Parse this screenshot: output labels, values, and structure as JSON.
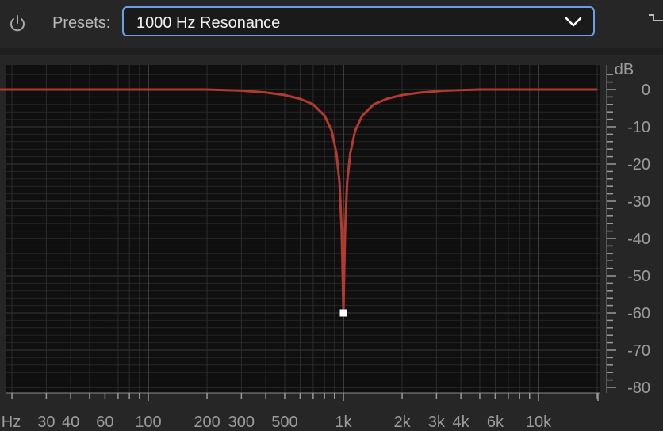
{
  "toolbar": {
    "power_icon": "power-icon",
    "presets_label": "Presets:",
    "preset_value": "1000 Hz Resonance",
    "chevron_icon": "chevron-down-icon",
    "corner_icon": "collapse-icon"
  },
  "colors": {
    "background": "#262626",
    "graph_bg": "#0f0f0f",
    "curve": "#b43a30",
    "select_border": "#6a9ee8",
    "handle": "#ffffff"
  },
  "chart_data": {
    "type": "line",
    "x_scale": "log",
    "xlim": [
      10,
      22000
    ],
    "ylim": [
      -82,
      5
    ],
    "x_unit": "Hz",
    "y_unit": "dB",
    "x_ticks": [
      {
        "label": "Hz",
        "value": 12,
        "major": false
      },
      {
        "label": "30",
        "value": 30,
        "major": false
      },
      {
        "label": "40",
        "value": 40,
        "major": false
      },
      {
        "label": "60",
        "value": 60,
        "major": false
      },
      {
        "label": "100",
        "value": 100,
        "major": true
      },
      {
        "label": "200",
        "value": 200,
        "major": false
      },
      {
        "label": "300",
        "value": 300,
        "major": false
      },
      {
        "label": "500",
        "value": 500,
        "major": false
      },
      {
        "label": "1k",
        "value": 1000,
        "major": true
      },
      {
        "label": "2k",
        "value": 2000,
        "major": false
      },
      {
        "label": "3k",
        "value": 3000,
        "major": false
      },
      {
        "label": "4k",
        "value": 4000,
        "major": false
      },
      {
        "label": "6k",
        "value": 6000,
        "major": false
      },
      {
        "label": "10k",
        "value": 10000,
        "major": true
      }
    ],
    "y_ticks": [
      {
        "label": "0",
        "value": 0
      },
      {
        "label": "-10",
        "value": -10
      },
      {
        "label": "-20",
        "value": -20
      },
      {
        "label": "-30",
        "value": -30
      },
      {
        "label": "-40",
        "value": -40
      },
      {
        "label": "-50",
        "value": -50
      },
      {
        "label": "-60",
        "value": -60
      },
      {
        "label": "-70",
        "value": -70
      },
      {
        "label": "-80",
        "value": -80
      }
    ],
    "series": [
      {
        "points": [
          [
            12,
            0
          ],
          [
            100,
            0
          ],
          [
            200,
            0
          ],
          [
            300,
            -0.3
          ],
          [
            400,
            -0.8
          ],
          [
            500,
            -1.5
          ],
          [
            600,
            -2.5
          ],
          [
            700,
            -4
          ],
          [
            800,
            -7
          ],
          [
            870,
            -11
          ],
          [
            920,
            -17
          ],
          [
            955,
            -25
          ],
          [
            980,
            -38
          ],
          [
            992,
            -50
          ],
          [
            1000,
            -60
          ],
          [
            1008,
            -50
          ],
          [
            1020,
            -38
          ],
          [
            1045,
            -25
          ],
          [
            1085,
            -17
          ],
          [
            1150,
            -11
          ],
          [
            1250,
            -7
          ],
          [
            1430,
            -4
          ],
          [
            1670,
            -2.5
          ],
          [
            2000,
            -1.5
          ],
          [
            2500,
            -0.8
          ],
          [
            3300,
            -0.3
          ],
          [
            5000,
            0
          ],
          [
            10000,
            0
          ],
          [
            20000,
            0
          ]
        ]
      }
    ],
    "handle": {
      "x": 1000,
      "y": -60
    }
  }
}
